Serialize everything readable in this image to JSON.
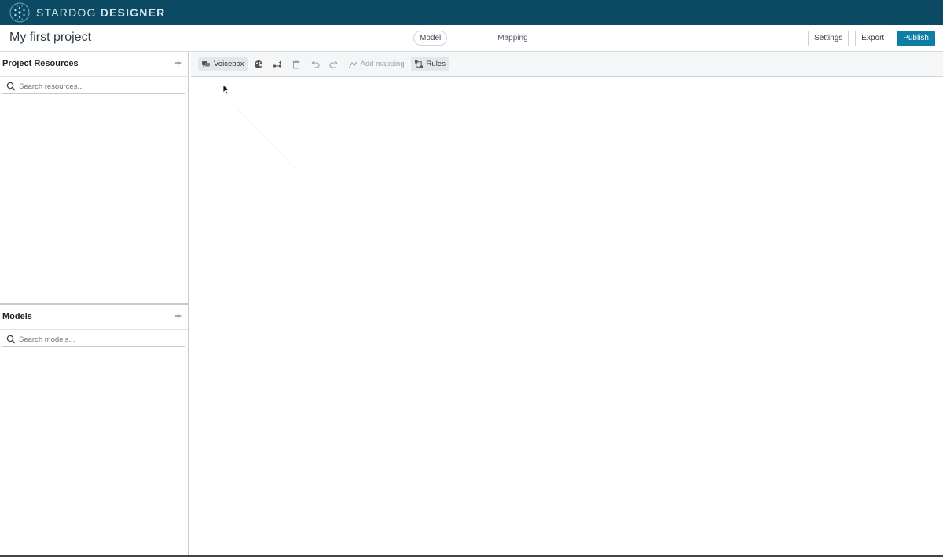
{
  "app": {
    "brand_light": "STARDOG",
    "brand_bold": "DESIGNER",
    "logo_icon": "stardog-logo-icon"
  },
  "header": {
    "project_title": "My first project",
    "steps": [
      {
        "label": "Model",
        "active": true
      },
      {
        "label": "Mapping",
        "active": false
      }
    ],
    "actions": {
      "settings": "Settings",
      "export": "Export",
      "publish": "Publish"
    }
  },
  "sidebar": {
    "resources": {
      "title": "Project Resources",
      "add": "+",
      "search_placeholder": "Search resources...",
      "search_value": ""
    },
    "models": {
      "title": "Models",
      "add": "+",
      "search_placeholder": "Search models...",
      "search_value": ""
    }
  },
  "toolbar": {
    "voicebox": "Voicebox",
    "add_mapping": "Add mapping",
    "rules": "Rules"
  },
  "colors": {
    "topbar": "#0b4a62",
    "primary": "#0d7ea3",
    "toolbar_bg": "#f4f6f7"
  }
}
